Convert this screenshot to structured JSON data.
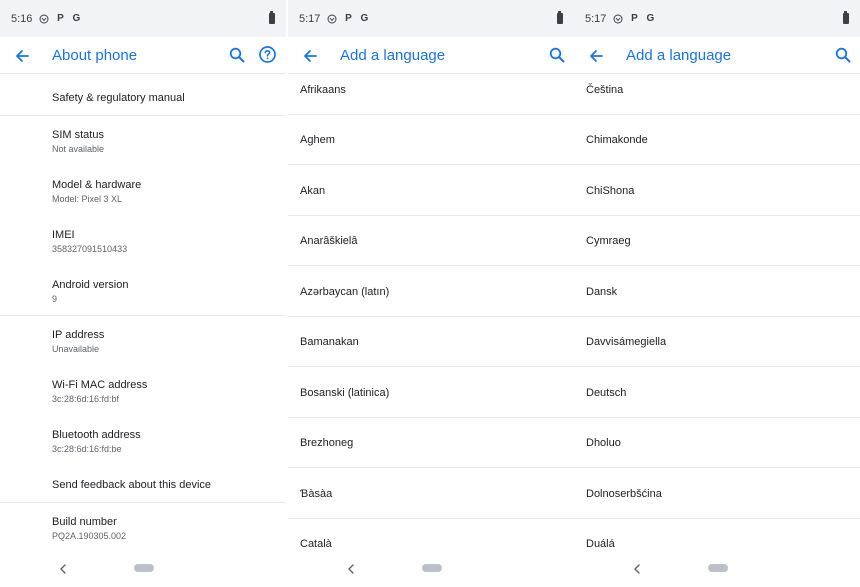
{
  "screens": [
    {
      "status_time": "5:16",
      "title": "About phone",
      "items": [
        {
          "title": "Safety & regulatory manual",
          "sub": ""
        },
        {
          "title": "SIM status",
          "sub": "Not available"
        },
        {
          "title": "Model & hardware",
          "sub": "Model: Pixel 3 XL"
        },
        {
          "title": "IMEI",
          "sub": "358327091510433"
        },
        {
          "title": "Android version",
          "sub": "9"
        },
        {
          "title": "IP address",
          "sub": "Unavailable"
        },
        {
          "title": "Wi-Fi MAC address",
          "sub": "3c:28:6d:16:fd:bf"
        },
        {
          "title": "Bluetooth address",
          "sub": "3c:28:6d:16:fd:be"
        },
        {
          "title": "Send feedback about this device",
          "sub": ""
        },
        {
          "title": "Build number",
          "sub": "PQ2A.190305.002"
        }
      ]
    },
    {
      "status_time": "5:17",
      "title": "Add a language",
      "languages": [
        "Afrikaans",
        "Aghem",
        "Akan",
        "Anarâškielâ",
        "Azərbaycan (latın)",
        "Bamanakan",
        "Bosanski (latinica)",
        "Brezhoneg",
        "Ɓàsàa",
        "Català"
      ]
    },
    {
      "status_time": "5:17",
      "title": "Add a language",
      "languages": [
        "Čeština",
        "Chimakonde",
        "ChiShona",
        "Cymraeg",
        "Dansk",
        "Davvisámegiella",
        "Deutsch",
        "Dholuo",
        "Dolnoserbšćina",
        "Duálá"
      ]
    }
  ],
  "status_icon_names": [
    "vpn-icon",
    "p-icon",
    "g-icon"
  ],
  "colors": {
    "accent": "#1a73e8",
    "statusbar": "#f1f3f4",
    "divider": "#e8eaed"
  }
}
